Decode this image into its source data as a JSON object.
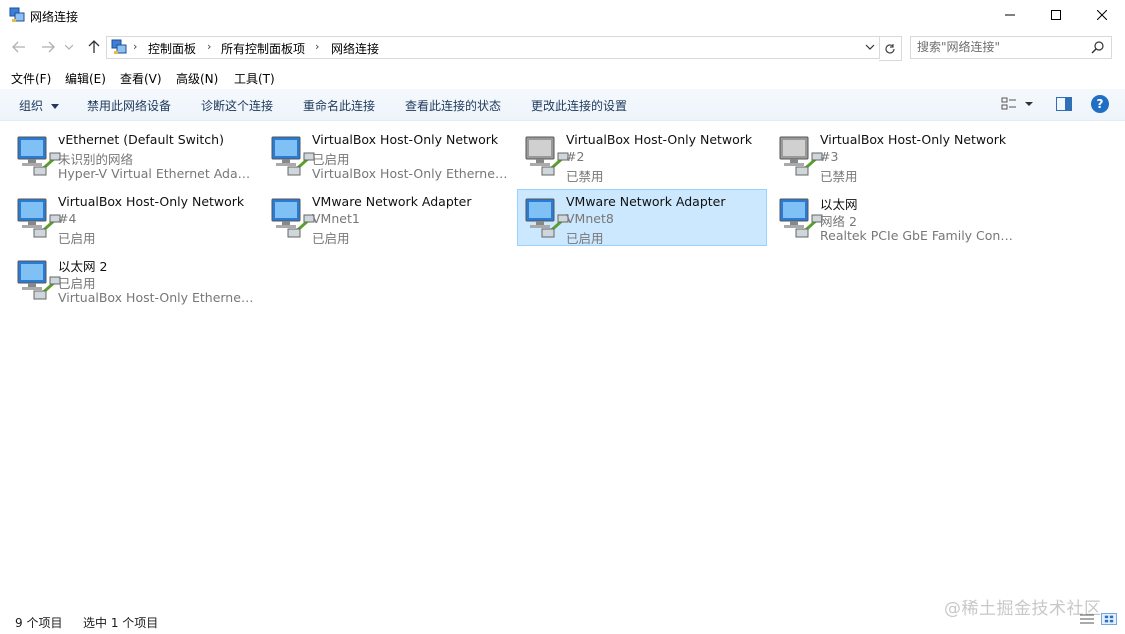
{
  "window": {
    "title": "网络连接",
    "min_icon": "minimize-icon",
    "max_icon": "maximize-icon",
    "close_icon": "close-icon"
  },
  "nav": {
    "back_icon": "arrow-left-icon",
    "forward_icon": "arrow-right-icon",
    "recent_icon": "chevron-down-icon",
    "up_icon": "arrow-up-icon",
    "breadcrumbs": [
      "控制面板",
      "所有控制面板项",
      "网络连接"
    ],
    "search_placeholder": "搜索\"网络连接\""
  },
  "menu": [
    "文件(F)",
    "编辑(E)",
    "查看(V)",
    "高级(N)",
    "工具(T)"
  ],
  "commands": {
    "organize": "组织",
    "disable": "禁用此网络设备",
    "diagnose": "诊断这个连接",
    "rename": "重命名此连接",
    "status": "查看此连接的状态",
    "settings": "更改此连接的设置"
  },
  "help_label": "?",
  "connections": [
    {
      "line1": "vEthernet (Default Switch)",
      "line2": "未识别的网络",
      "line3": "Hyper-V Virtual Ethernet Adap...",
      "enabled": true,
      "selected": false
    },
    {
      "line1": "VirtualBox Host-Only Network",
      "line2": "已启用",
      "line3": "VirtualBox Host-Only Ethernet ...",
      "enabled": true,
      "selected": false
    },
    {
      "line1": "VirtualBox Host-Only Network",
      "line2": "#2",
      "line3": "已禁用",
      "enabled": false,
      "selected": false
    },
    {
      "line1": "VirtualBox Host-Only Network",
      "line2": "#3",
      "line3": "已禁用",
      "enabled": false,
      "selected": false
    },
    {
      "line1": "VirtualBox Host-Only Network",
      "line2": "#4",
      "line3": "已启用",
      "enabled": true,
      "selected": false
    },
    {
      "line1": "VMware Network Adapter",
      "line2": "VMnet1",
      "line3": "已启用",
      "enabled": true,
      "selected": false
    },
    {
      "line1": "VMware Network Adapter",
      "line2": "VMnet8",
      "line3": "已启用",
      "enabled": true,
      "selected": true
    },
    {
      "line1": "以太网",
      "line2": "网络 2",
      "line3": "Realtek PCIe GbE Family Contr...",
      "enabled": true,
      "selected": false
    },
    {
      "line1": "以太网 2",
      "line2": "已启用",
      "line3": "VirtualBox Host-Only Ethernet ...",
      "enabled": true,
      "selected": false
    }
  ],
  "statusbar": {
    "count": "9 个项目",
    "selected": "选中 1 个项目"
  },
  "watermark": "@稀土掘金技术社区",
  "colors": {
    "selection_bg": "#cce8ff",
    "selection_border": "#99d1ff",
    "command_text": "#1e395b",
    "help_blue": "#1f6fc5"
  }
}
